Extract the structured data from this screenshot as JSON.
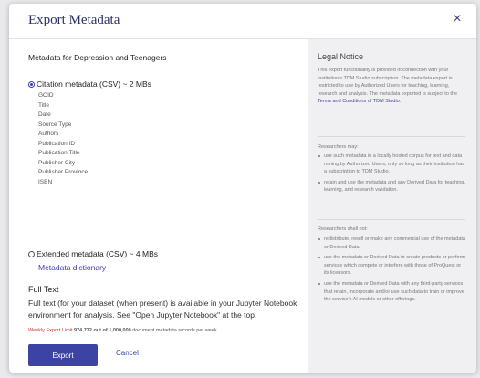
{
  "dialog": {
    "title": "Export Metadata",
    "close_label": "×"
  },
  "dataset_label": "Metadata for Depression and Teenagers",
  "options": {
    "citation": {
      "label": "Citation metadata (CSV) ~ 2 MBs",
      "selected": true,
      "fields": [
        "GOID",
        "Title",
        "Date",
        "Source Type",
        "Authors",
        "Publication ID",
        "Publication Title",
        "Publisher City",
        "Publisher Province",
        "ISBN"
      ]
    },
    "extended": {
      "label": "Extended metadata (CSV) ~ 4 MBs",
      "selected": false,
      "dictionary_link": "Metadata dictionary"
    }
  },
  "full_text": {
    "title": "Full Text",
    "body": "Full text (for your dataset (when present) is available in your Jupyter Notebook environment for analysis. See \"Open Jupyter Notebook\" at the top."
  },
  "limit": {
    "label": "Weekly Export Limit",
    "count": "974,772 out of 1,000,000",
    "suffix": "document metadata records per week"
  },
  "actions": {
    "export_label": "Export",
    "cancel_label": "Cancel"
  },
  "legal": {
    "title": "Legal Notice",
    "intro": "This export functionality is provided in connection with your institution's TDM Studio subscription. The metadata export is restricted to use by Authorized Users for teaching, learning, research and analysis. The metadata exported is subject to the ",
    "terms_link": "Terms and Conditions of TDM Studio",
    "intro_end": ".",
    "may_label": "Researchers may:",
    "may_items": [
      "use such metadata in a locally hosted corpus for text and data mining by Authorized Users, only so long as their institution has a subscription to TDM Studio.",
      "retain and use the metadata and any Derived Data for teaching, learning, and research validation."
    ],
    "shall_not_label": "Researchers shall not:",
    "shall_not_items": [
      "redistribute, resell or make any commercial use of the metadata or Derived Data.",
      "use the metadata or Derived Data to create products or perform services which compete or interfere with those of ProQuest or its licensors.",
      "use the metadata or Derived Data with any third-party services that retain, incorporate and/or use such data to train or improve the service's AI models or other offerings."
    ]
  },
  "colors": {
    "accent": "#3d43a5",
    "title": "#2b2f63",
    "limit_red": "#c7332c",
    "panel": "#f0f0f2"
  }
}
